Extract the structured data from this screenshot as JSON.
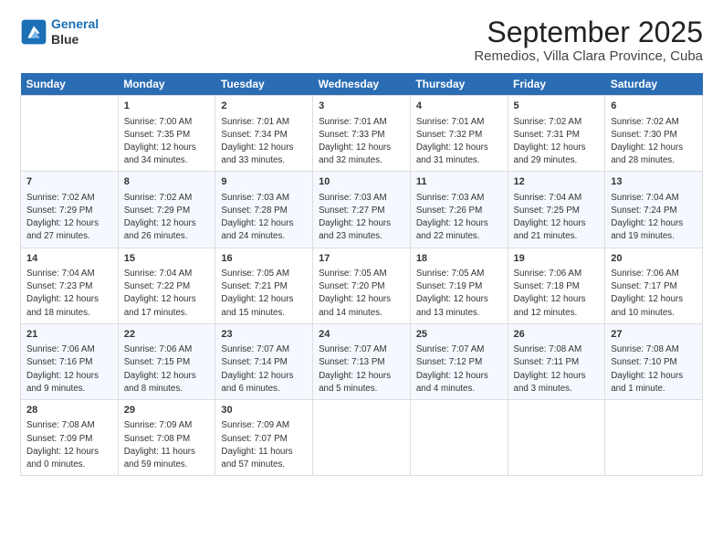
{
  "header": {
    "logo_line1": "General",
    "logo_line2": "Blue",
    "title": "September 2025",
    "subtitle": "Remedios, Villa Clara Province, Cuba"
  },
  "weekdays": [
    "Sunday",
    "Monday",
    "Tuesday",
    "Wednesday",
    "Thursday",
    "Friday",
    "Saturday"
  ],
  "weeks": [
    [
      {
        "num": "",
        "lines": []
      },
      {
        "num": "1",
        "lines": [
          "Sunrise: 7:00 AM",
          "Sunset: 7:35 PM",
          "Daylight: 12 hours",
          "and 34 minutes."
        ]
      },
      {
        "num": "2",
        "lines": [
          "Sunrise: 7:01 AM",
          "Sunset: 7:34 PM",
          "Daylight: 12 hours",
          "and 33 minutes."
        ]
      },
      {
        "num": "3",
        "lines": [
          "Sunrise: 7:01 AM",
          "Sunset: 7:33 PM",
          "Daylight: 12 hours",
          "and 32 minutes."
        ]
      },
      {
        "num": "4",
        "lines": [
          "Sunrise: 7:01 AM",
          "Sunset: 7:32 PM",
          "Daylight: 12 hours",
          "and 31 minutes."
        ]
      },
      {
        "num": "5",
        "lines": [
          "Sunrise: 7:02 AM",
          "Sunset: 7:31 PM",
          "Daylight: 12 hours",
          "and 29 minutes."
        ]
      },
      {
        "num": "6",
        "lines": [
          "Sunrise: 7:02 AM",
          "Sunset: 7:30 PM",
          "Daylight: 12 hours",
          "and 28 minutes."
        ]
      }
    ],
    [
      {
        "num": "7",
        "lines": [
          "Sunrise: 7:02 AM",
          "Sunset: 7:29 PM",
          "Daylight: 12 hours",
          "and 27 minutes."
        ]
      },
      {
        "num": "8",
        "lines": [
          "Sunrise: 7:02 AM",
          "Sunset: 7:29 PM",
          "Daylight: 12 hours",
          "and 26 minutes."
        ]
      },
      {
        "num": "9",
        "lines": [
          "Sunrise: 7:03 AM",
          "Sunset: 7:28 PM",
          "Daylight: 12 hours",
          "and 24 minutes."
        ]
      },
      {
        "num": "10",
        "lines": [
          "Sunrise: 7:03 AM",
          "Sunset: 7:27 PM",
          "Daylight: 12 hours",
          "and 23 minutes."
        ]
      },
      {
        "num": "11",
        "lines": [
          "Sunrise: 7:03 AM",
          "Sunset: 7:26 PM",
          "Daylight: 12 hours",
          "and 22 minutes."
        ]
      },
      {
        "num": "12",
        "lines": [
          "Sunrise: 7:04 AM",
          "Sunset: 7:25 PM",
          "Daylight: 12 hours",
          "and 21 minutes."
        ]
      },
      {
        "num": "13",
        "lines": [
          "Sunrise: 7:04 AM",
          "Sunset: 7:24 PM",
          "Daylight: 12 hours",
          "and 19 minutes."
        ]
      }
    ],
    [
      {
        "num": "14",
        "lines": [
          "Sunrise: 7:04 AM",
          "Sunset: 7:23 PM",
          "Daylight: 12 hours",
          "and 18 minutes."
        ]
      },
      {
        "num": "15",
        "lines": [
          "Sunrise: 7:04 AM",
          "Sunset: 7:22 PM",
          "Daylight: 12 hours",
          "and 17 minutes."
        ]
      },
      {
        "num": "16",
        "lines": [
          "Sunrise: 7:05 AM",
          "Sunset: 7:21 PM",
          "Daylight: 12 hours",
          "and 15 minutes."
        ]
      },
      {
        "num": "17",
        "lines": [
          "Sunrise: 7:05 AM",
          "Sunset: 7:20 PM",
          "Daylight: 12 hours",
          "and 14 minutes."
        ]
      },
      {
        "num": "18",
        "lines": [
          "Sunrise: 7:05 AM",
          "Sunset: 7:19 PM",
          "Daylight: 12 hours",
          "and 13 minutes."
        ]
      },
      {
        "num": "19",
        "lines": [
          "Sunrise: 7:06 AM",
          "Sunset: 7:18 PM",
          "Daylight: 12 hours",
          "and 12 minutes."
        ]
      },
      {
        "num": "20",
        "lines": [
          "Sunrise: 7:06 AM",
          "Sunset: 7:17 PM",
          "Daylight: 12 hours",
          "and 10 minutes."
        ]
      }
    ],
    [
      {
        "num": "21",
        "lines": [
          "Sunrise: 7:06 AM",
          "Sunset: 7:16 PM",
          "Daylight: 12 hours",
          "and 9 minutes."
        ]
      },
      {
        "num": "22",
        "lines": [
          "Sunrise: 7:06 AM",
          "Sunset: 7:15 PM",
          "Daylight: 12 hours",
          "and 8 minutes."
        ]
      },
      {
        "num": "23",
        "lines": [
          "Sunrise: 7:07 AM",
          "Sunset: 7:14 PM",
          "Daylight: 12 hours",
          "and 6 minutes."
        ]
      },
      {
        "num": "24",
        "lines": [
          "Sunrise: 7:07 AM",
          "Sunset: 7:13 PM",
          "Daylight: 12 hours",
          "and 5 minutes."
        ]
      },
      {
        "num": "25",
        "lines": [
          "Sunrise: 7:07 AM",
          "Sunset: 7:12 PM",
          "Daylight: 12 hours",
          "and 4 minutes."
        ]
      },
      {
        "num": "26",
        "lines": [
          "Sunrise: 7:08 AM",
          "Sunset: 7:11 PM",
          "Daylight: 12 hours",
          "and 3 minutes."
        ]
      },
      {
        "num": "27",
        "lines": [
          "Sunrise: 7:08 AM",
          "Sunset: 7:10 PM",
          "Daylight: 12 hours",
          "and 1 minute."
        ]
      }
    ],
    [
      {
        "num": "28",
        "lines": [
          "Sunrise: 7:08 AM",
          "Sunset: 7:09 PM",
          "Daylight: 12 hours",
          "and 0 minutes."
        ]
      },
      {
        "num": "29",
        "lines": [
          "Sunrise: 7:09 AM",
          "Sunset: 7:08 PM",
          "Daylight: 11 hours",
          "and 59 minutes."
        ]
      },
      {
        "num": "30",
        "lines": [
          "Sunrise: 7:09 AM",
          "Sunset: 7:07 PM",
          "Daylight: 11 hours",
          "and 57 minutes."
        ]
      },
      {
        "num": "",
        "lines": []
      },
      {
        "num": "",
        "lines": []
      },
      {
        "num": "",
        "lines": []
      },
      {
        "num": "",
        "lines": []
      }
    ]
  ]
}
